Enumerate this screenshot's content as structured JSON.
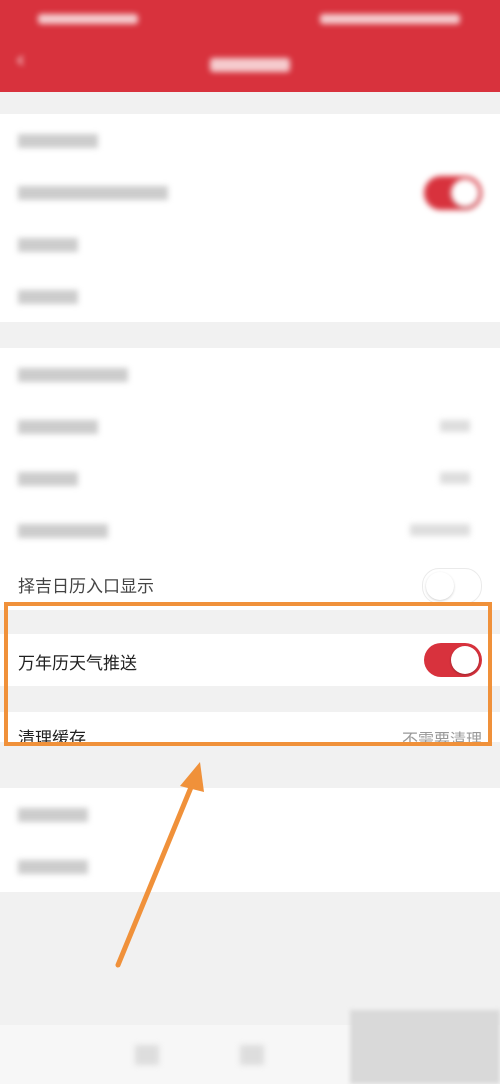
{
  "header": {
    "title": "",
    "status_left": "",
    "status_right": ""
  },
  "sections": [
    {
      "rows": [
        {
          "label": "",
          "type": "chevron"
        },
        {
          "label": "",
          "type": "toggle",
          "on": true
        },
        {
          "label": "",
          "type": "chevron"
        },
        {
          "label": "",
          "type": "chevron"
        }
      ]
    },
    {
      "rows": [
        {
          "label": "",
          "type": "chevron"
        },
        {
          "label": "",
          "value": "",
          "type": "value"
        },
        {
          "label": "",
          "value": "",
          "type": "value"
        },
        {
          "label": "",
          "value": "",
          "type": "value"
        }
      ]
    }
  ],
  "visible_rows": {
    "zeji_entry": {
      "label": "择吉日历入口显示",
      "on": false
    },
    "weather_push": {
      "label": "万年历天气推送",
      "on": true
    },
    "clear_cache": {
      "label": "清理缓存",
      "value": "不需要清理"
    }
  },
  "colors": {
    "brand_red": "#d8323d",
    "highlight_orange": "#f0913a",
    "bg_gray": "#f1f1f1"
  },
  "icons": {
    "back": "back-arrow-icon",
    "arrow_annotation": "annotation-arrow-icon"
  }
}
